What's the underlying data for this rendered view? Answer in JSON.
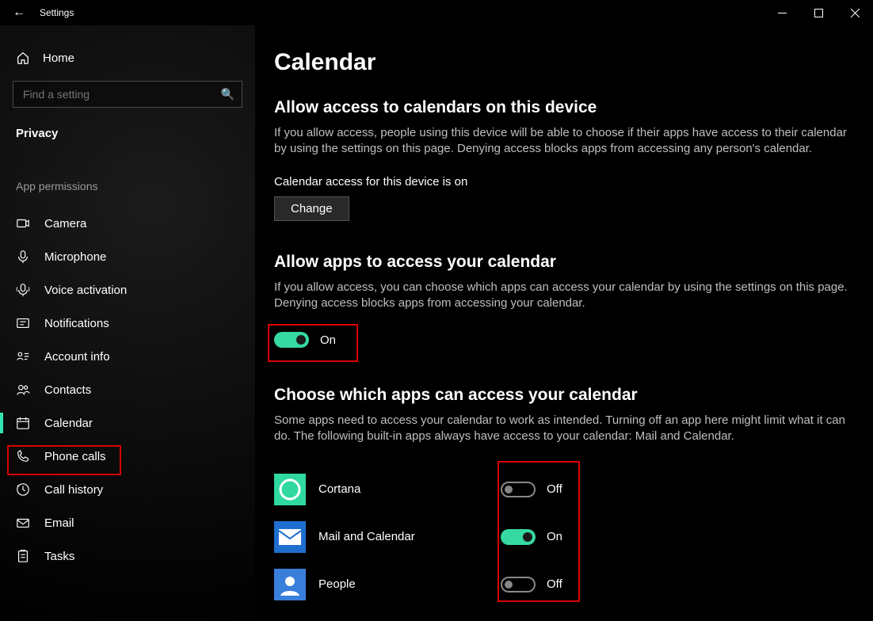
{
  "window": {
    "title": "Settings"
  },
  "sidebar": {
    "home": "Home",
    "search_placeholder": "Find a setting",
    "category": "Privacy",
    "group_label": "App permissions",
    "items": [
      {
        "id": "camera",
        "label": "Camera"
      },
      {
        "id": "microphone",
        "label": "Microphone"
      },
      {
        "id": "voice-activation",
        "label": "Voice activation"
      },
      {
        "id": "notifications",
        "label": "Notifications"
      },
      {
        "id": "account-info",
        "label": "Account info"
      },
      {
        "id": "contacts",
        "label": "Contacts"
      },
      {
        "id": "calendar",
        "label": "Calendar",
        "active": true
      },
      {
        "id": "phone-calls",
        "label": "Phone calls"
      },
      {
        "id": "call-history",
        "label": "Call history"
      },
      {
        "id": "email",
        "label": "Email"
      },
      {
        "id": "tasks",
        "label": "Tasks"
      }
    ]
  },
  "page": {
    "title": "Calendar",
    "section1": {
      "heading": "Allow access to calendars on this device",
      "desc": "If you allow access, people using this device will be able to choose if their apps have access to their calendar by using the settings on this page. Denying access blocks apps from accessing any person's calendar.",
      "status": "Calendar access for this device is on",
      "change_btn": "Change"
    },
    "section2": {
      "heading": "Allow apps to access your calendar",
      "desc": "If you allow access, you can choose which apps can access your calendar by using the settings on this page. Denying access blocks apps from accessing your calendar.",
      "toggle_on": true,
      "toggle_label": "On"
    },
    "section3": {
      "heading": "Choose which apps can access your calendar",
      "desc": "Some apps need to access your calendar to work as intended. Turning off an app here might limit what it can do. The following built-in apps always have access to your calendar: Mail and Calendar.",
      "apps": [
        {
          "name": "Cortana",
          "on": false,
          "label": "Off",
          "color": "#2fd9a1"
        },
        {
          "name": "Mail and Calendar",
          "on": true,
          "label": "On",
          "color": "#1f6fd0"
        },
        {
          "name": "People",
          "on": false,
          "label": "Off",
          "color": "#3a7edb"
        }
      ]
    }
  }
}
